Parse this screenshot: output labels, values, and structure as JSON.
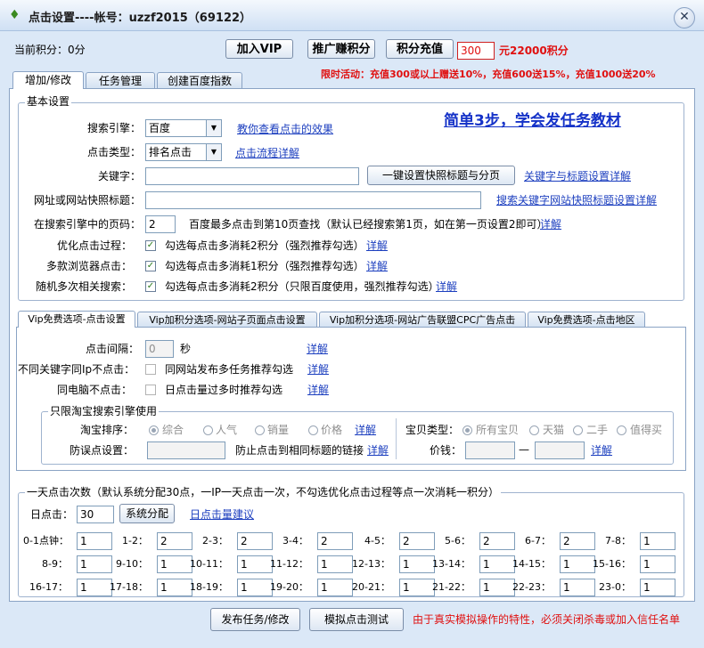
{
  "window": {
    "title": "点击设置----帐号：uzzf2015（69122）"
  },
  "topbar": {
    "points_label": "当前积分：0分",
    "vip_button": "加入VIP",
    "promote_button": "推广赚积分",
    "recharge_button": "积分充值",
    "recharge_amount": "300",
    "recharge_points_text": "元22000积分",
    "promo_text": "限时活动：充值300或以上赠送10%，充值600送15%，充值1000送20%"
  },
  "main_tabs": [
    "增加/修改",
    "任务管理",
    "创建百度指数"
  ],
  "basic": {
    "legend": "基本设置",
    "headline": "简单3步，学会发任务教材",
    "engine_label": "搜索引擎：",
    "engine_value": "百度",
    "engine_link": "教你查看点击的效果",
    "type_label": "点击类型：",
    "type_value": "排名点击",
    "type_link": "点击流程详解",
    "keyword_label": "关键字：",
    "keyword_value": "",
    "keyword_button": "一键设置快照标题与分页",
    "keyword_link": "关键字与标题设置详解",
    "url_label": "网址或网站快照标题：",
    "url_value": "",
    "url_link": "搜索关键字网站快照标题设置详解",
    "page_label": "在搜索引擎中的页码：",
    "page_value": "2",
    "page_note": "百度最多点击到第10页查找（默认已经搜索第1页，如在第一页设置2即可）",
    "page_link": "详解",
    "opt_label": "优化点击过程：",
    "opt_text": "勾选每点击多消耗2积分（强烈推荐勾选）",
    "opt_link": "详解",
    "browser_label": "多款浏览器点击：",
    "browser_text": "勾选每点击多消耗1积分（强烈推荐勾选）",
    "browser_link": "详解",
    "random_label": "随机多次相关搜索：",
    "random_text": "勾选每点击多消耗2积分（只限百度使用，强烈推荐勾选）",
    "random_link": "详解"
  },
  "vip_tabs": [
    "Vip免费选项-点击设置",
    "Vip加积分选项-网站子页面点击设置",
    "Vip加积分选项-网站广告联盟CPC广告点击",
    "Vip免费选项-点击地区"
  ],
  "vip": {
    "interval_label": "点击间隔：",
    "interval_value": "0",
    "interval_unit": "秒",
    "interval_link": "详解",
    "ip_label": "不同关键字同Ip不点击：",
    "ip_text": "同网站发布多任务推荐勾选",
    "ip_link": "详解",
    "pc_label": "同电脑不点击：",
    "pc_text": "日点击量过多时推荐勾选",
    "pc_link": "详解",
    "taobao_legend": "只限淘宝搜索引擎使用",
    "sort_label": "淘宝排序：",
    "sort_options": [
      "综合",
      "人气",
      "销量",
      "价格"
    ],
    "sort_link": "详解",
    "misclick_label": "防误点设置：",
    "misclick_value": "",
    "misclick_text": "防止点击到相同标题的链接",
    "misclick_link": "详解",
    "item_type_label": "宝贝类型：",
    "item_type_options": [
      "所有宝贝",
      "天猫",
      "二手",
      "值得买"
    ],
    "price_label": "价钱：",
    "price_min": "",
    "price_dash": "—",
    "price_max": "",
    "price_link": "详解"
  },
  "daily": {
    "legend": "一天点击次数（默认系统分配30点，一IP一天点击一次，不勾选优化点击过程等点一次消耗一积分）",
    "clicks_label": "日点击：",
    "clicks_value": "30",
    "assign_button": "系统分配",
    "suggest_link": "日点击量建议",
    "slots": [
      {
        "label": "0-1点钟：",
        "value": "1"
      },
      {
        "label": "1-2：",
        "value": "2"
      },
      {
        "label": "2-3：",
        "value": "2"
      },
      {
        "label": "3-4：",
        "value": "2"
      },
      {
        "label": "4-5：",
        "value": "2"
      },
      {
        "label": "5-6：",
        "value": "2"
      },
      {
        "label": "6-7：",
        "value": "2"
      },
      {
        "label": "7-8：",
        "value": "1"
      },
      {
        "label": "8-9：",
        "value": "1"
      },
      {
        "label": "9-10：",
        "value": "1"
      },
      {
        "label": "10-11：",
        "value": "1"
      },
      {
        "label": "11-12：",
        "value": "1"
      },
      {
        "label": "12-13：",
        "value": "1"
      },
      {
        "label": "13-14：",
        "value": "1"
      },
      {
        "label": "14-15：",
        "value": "1"
      },
      {
        "label": "15-16：",
        "value": "1"
      },
      {
        "label": "16-17：",
        "value": "1"
      },
      {
        "label": "17-18：",
        "value": "1"
      },
      {
        "label": "18-19：",
        "value": "1"
      },
      {
        "label": "19-20：",
        "value": "1"
      },
      {
        "label": "20-21：",
        "value": "1"
      },
      {
        "label": "21-22：",
        "value": "1"
      },
      {
        "label": "22-23：",
        "value": "1"
      },
      {
        "label": "23-0：",
        "value": "1"
      }
    ]
  },
  "footer": {
    "publish_button": "发布任务/修改",
    "simulate_button": "模拟点击测试",
    "warning": "由于真实模拟操作的特性，必须关闭杀毒或加入信任名单"
  }
}
